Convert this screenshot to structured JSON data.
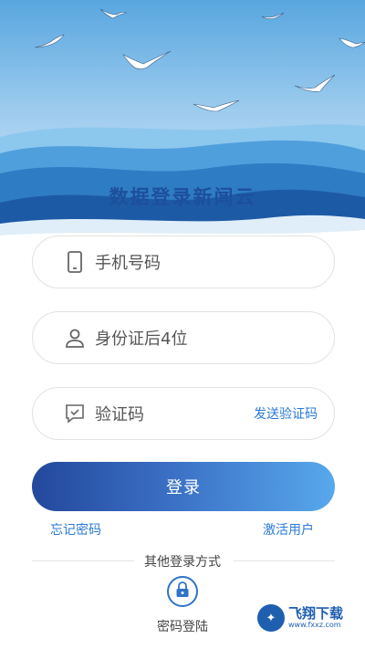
{
  "header": {
    "title": "数据登录新闻云"
  },
  "form": {
    "phone": {
      "placeholder": "手机号码",
      "icon": "phone-icon"
    },
    "id_number": {
      "placeholder": "身份证后4位",
      "icon": "user-icon"
    },
    "code": {
      "placeholder": "验证码",
      "icon": "verify-message-icon",
      "send_label": "发送验证码"
    }
  },
  "login_button": {
    "label": "登录"
  },
  "links": {
    "forgot_password": "忘记密码",
    "activate_user": "激活用户"
  },
  "other_login": {
    "title": "其他登录方式",
    "methods": [
      {
        "label": "密码登陆",
        "icon": "lock-icon"
      }
    ]
  },
  "watermark": {
    "name": "飞翔下载",
    "url": "www.fxxz.com"
  },
  "colors": {
    "accent": "#2a7ad6",
    "button_start": "#23489c",
    "button_end": "#58a8ec",
    "sea_dark": "#1d4f9c"
  }
}
